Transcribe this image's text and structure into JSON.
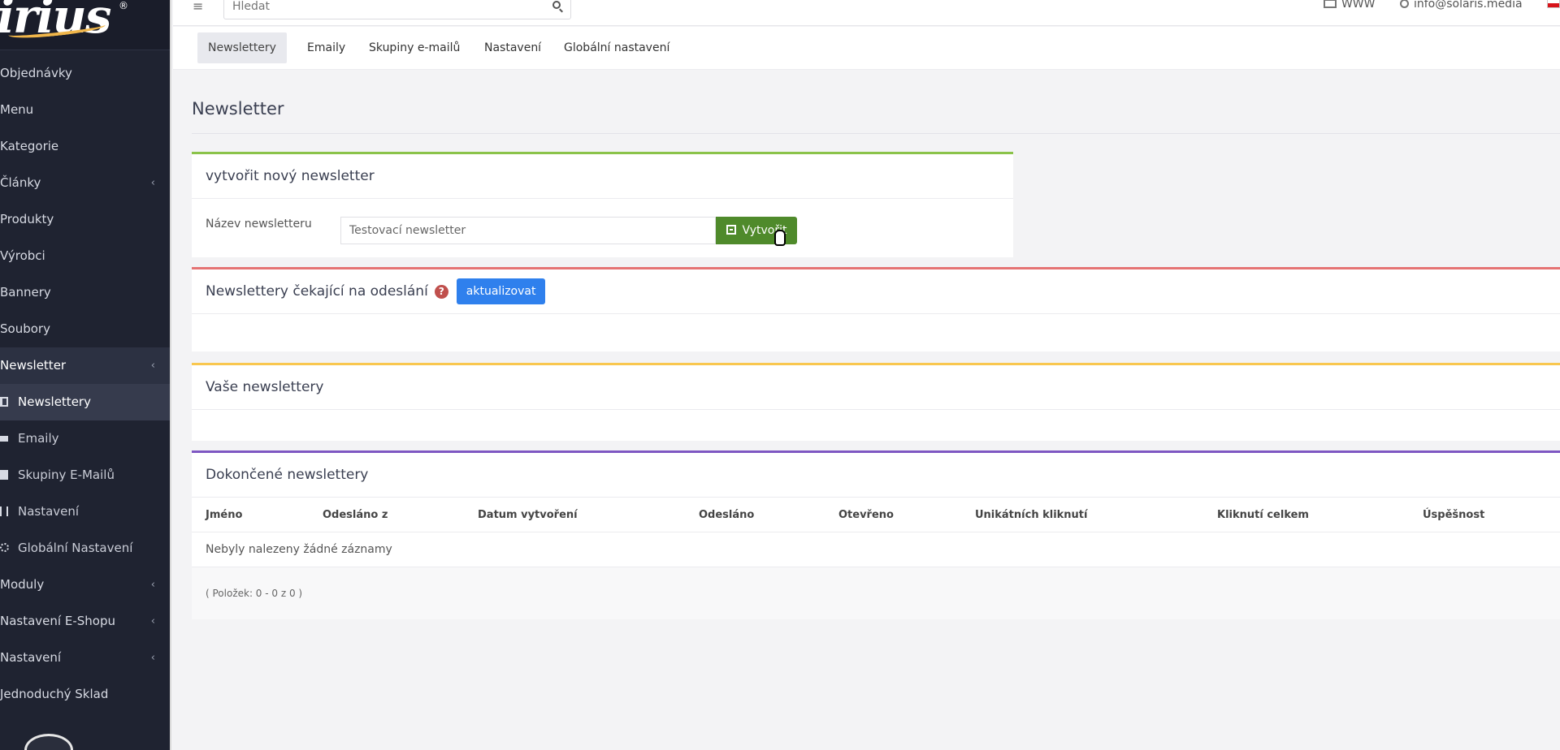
{
  "app": {
    "logo_text": "irius",
    "logo_reg": "®"
  },
  "topbar": {
    "search_placeholder": "Hledat",
    "www_label": "WWW",
    "user_email": "info@solaris.media"
  },
  "sidebar": {
    "items": [
      {
        "label": "Objednávky"
      },
      {
        "label": "Menu"
      },
      {
        "label": "Kategorie"
      },
      {
        "label": "Články"
      },
      {
        "label": "Produkty"
      },
      {
        "label": "Výrobci"
      },
      {
        "label": "Bannery"
      },
      {
        "label": "Soubory"
      },
      {
        "label": "Newsletter"
      },
      {
        "label": "Newslettery"
      },
      {
        "label": "Emaily"
      },
      {
        "label": "Skupiny E-Mailů"
      },
      {
        "label": "Nastavení"
      },
      {
        "label": "Globální Nastavení"
      },
      {
        "label": "Moduly"
      },
      {
        "label": "Nastavení E-Shopu"
      },
      {
        "label": "Nastavení"
      },
      {
        "label": "Jednoduchý Sklad"
      }
    ]
  },
  "tabs": [
    {
      "label": "Newslettery"
    },
    {
      "label": "Emaily"
    },
    {
      "label": "Skupiny e-mailů"
    },
    {
      "label": "Nastavení"
    },
    {
      "label": "Globální nastavení"
    }
  ],
  "page": {
    "title": "Newsletter"
  },
  "create_panel": {
    "title": "vytvořit nový newsletter",
    "name_label": "Název newsletteru",
    "name_value": "Testovací newsletter",
    "create_button": "Vytvořit"
  },
  "waiting_panel": {
    "title": "Newslettery čekající na odeslání",
    "help_symbol": "?",
    "update_button": "aktualizovat"
  },
  "yours_panel": {
    "title": "Vaše newslettery"
  },
  "done_panel": {
    "title": "Dokončené newslettery",
    "columns": [
      "Jméno",
      "Odesláno z",
      "Datum vytvoření",
      "Odesláno",
      "Otevřeno",
      "Unikátních kliknutí",
      "Kliknutí celkem",
      "Úspěšnost"
    ],
    "empty_text": "Nebyly nalezeny žádné záznamy",
    "pager_text": "( Položek: 0 - 0 z 0 )"
  },
  "colors": {
    "sidebar_bg": "#1f2331",
    "create_accent": "#8bc34a",
    "waiting_accent": "#e57373",
    "yours_accent": "#f9c74f",
    "done_accent": "#7e57c2",
    "create_button": "#4f8a2b",
    "update_button": "#2f80ed"
  },
  "icons": {
    "hamburger": "menu-icon",
    "search": "search-icon",
    "www": "monitor-icon",
    "user": "user-icon",
    "language": "czech-flag-icon",
    "create": "plus-square-icon",
    "help": "question-circle-icon",
    "cursor": "hand-cursor-icon"
  }
}
